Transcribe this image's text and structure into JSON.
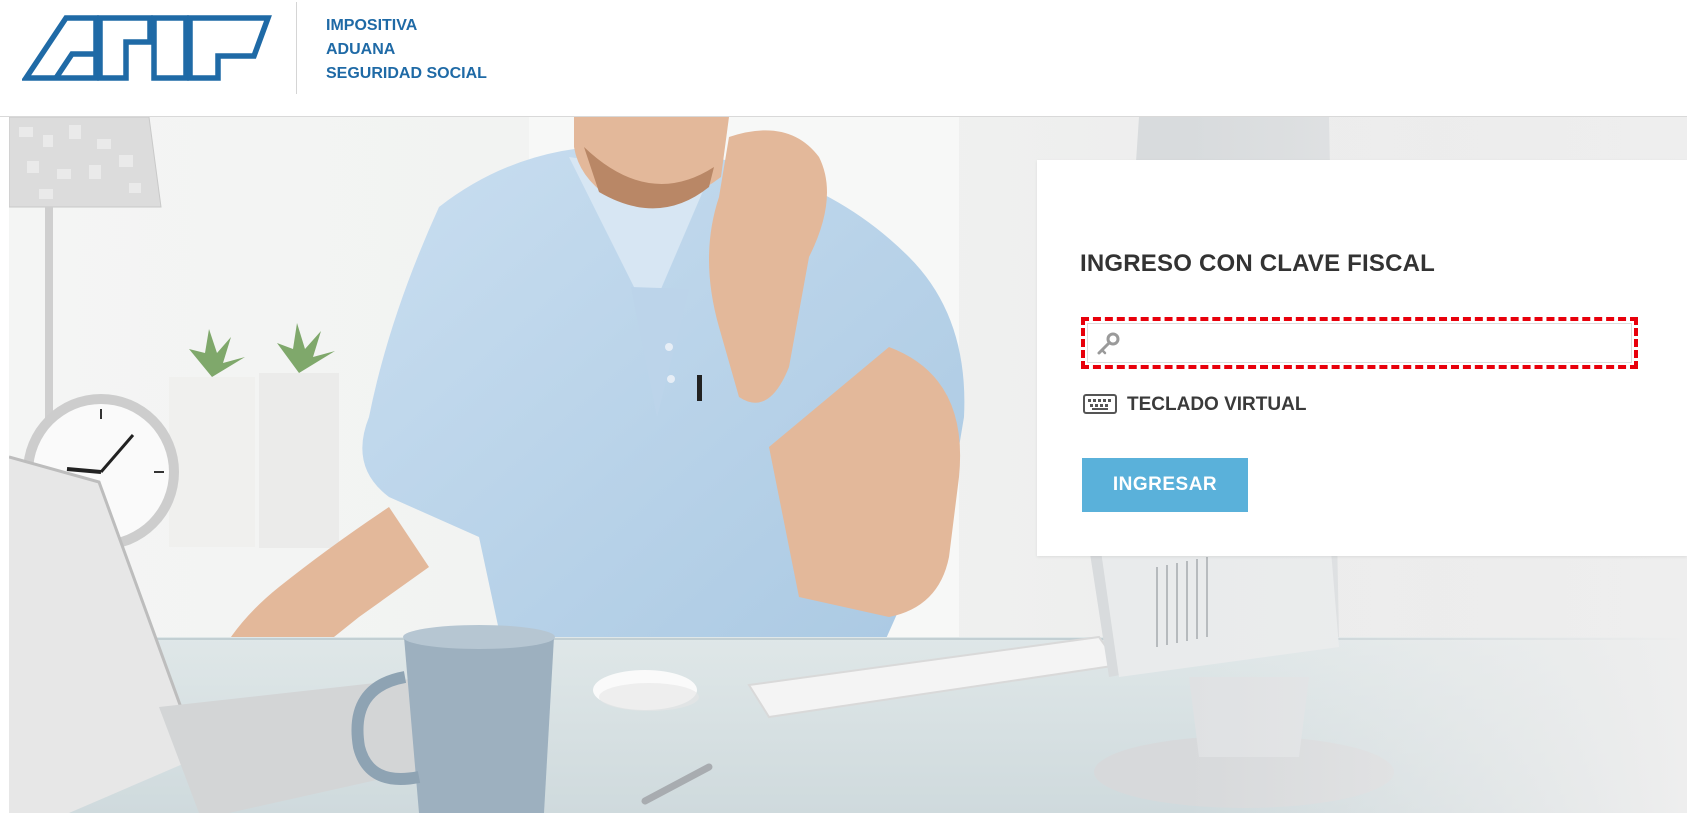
{
  "header": {
    "logo_text": "AFIP",
    "tagline": [
      "IMPOSITIVA",
      "ADUANA",
      "SEGURIDAD SOCIAL"
    ]
  },
  "login": {
    "title": "INGRESO CON CLAVE FISCAL",
    "password_value": "",
    "virtual_keyboard_label": "TECLADO VIRTUAL",
    "submit_label": "INGRESAR",
    "highlight_color": "#e8000b",
    "button_color": "#5ab1da"
  },
  "icons": {
    "field": "key-icon",
    "virtual_keyboard": "keyboard-icon"
  }
}
